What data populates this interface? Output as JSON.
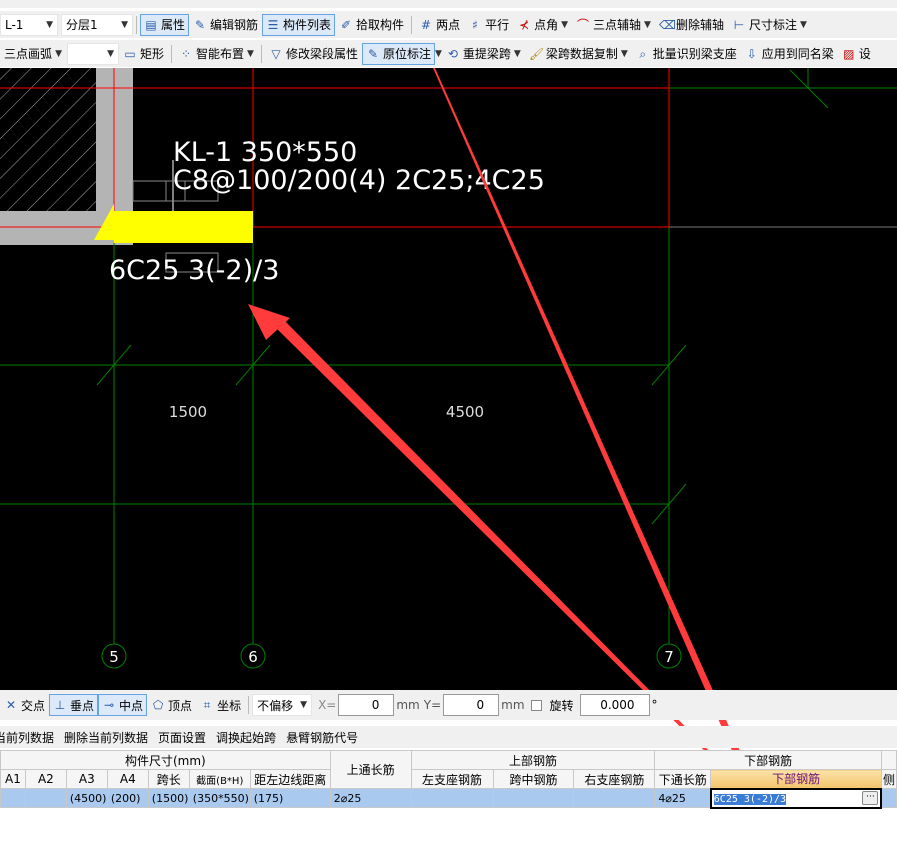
{
  "toolbar1": {
    "component": "L-1",
    "floor": "分层1",
    "items": [
      "属性",
      "编辑钢筋",
      "构件列表",
      "拾取构件",
      "两点",
      "平行",
      "点角",
      "三点辅轴",
      "删除辅轴",
      "尺寸标注"
    ]
  },
  "toolbar2": {
    "arc_mode": "三点画弧",
    "items": [
      "矩形",
      "智能布置",
      "修改梁段属性",
      "原位标注",
      "重提梁跨",
      "梁跨数据复制",
      "批量识别梁支座",
      "应用到同名梁",
      "设"
    ]
  },
  "drawing": {
    "beam_name": "KL-1 350*550",
    "beam_stirrup": "C8@100/200(4) 2C25;4C25",
    "bottom_rebar": "6C25 3(-2)/3",
    "span1": "1500",
    "span2": "4500",
    "axes": [
      "5",
      "6",
      "7"
    ],
    "colors": {
      "beam": "#ffff00",
      "axis": "#008000",
      "selected": "#ff0000",
      "arrow": "#ff3b3b"
    }
  },
  "snapbar": {
    "items": [
      "交点",
      "垂点",
      "中点",
      "顶点",
      "坐标"
    ],
    "offset": "不偏移",
    "x_label": "X=",
    "x": "0",
    "y_label": "Y=",
    "y": "0",
    "unit": "mm",
    "rotate_label": "旋转",
    "rotate": "0.000",
    "deg": "°"
  },
  "actions": [
    "当前列数据",
    "删除当前列数据",
    "页面设置",
    "调换起始跨",
    "悬臂钢筋代号"
  ],
  "table": {
    "group1": "构件尺寸(mm)",
    "top_long": "上通长筋",
    "group2": "上部钢筋",
    "group3": "下部钢筋",
    "cols": [
      "A1",
      "A2",
      "A3",
      "A4",
      "跨长",
      "截面(B*H)",
      "距左边线距离"
    ],
    "cols2": [
      "左支座钢筋",
      "跨中钢筋",
      "右支座钢筋",
      "下通长筋",
      "下部钢筋",
      "侧"
    ],
    "row": [
      "",
      "",
      "(4500)",
      "(200)",
      "(1500)",
      "(350*550)",
      "(175)",
      "2⌀25",
      "",
      "",
      "",
      "4⌀25",
      "6C25 3(-2)/3",
      ""
    ]
  }
}
